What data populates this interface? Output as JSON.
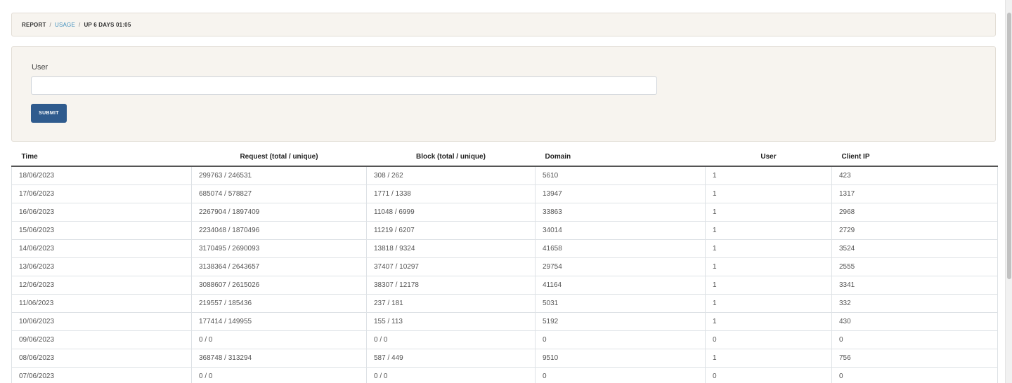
{
  "breadcrumb": {
    "report": "REPORT",
    "separator": "/",
    "usage": "USAGE",
    "uptime": "UP 6 DAYS 01:05"
  },
  "filter": {
    "user_label": "User",
    "user_value": "",
    "user_placeholder": "",
    "submit_label": "SUBMIT"
  },
  "table": {
    "headers": {
      "time": "Time",
      "request": "Request (total / unique)",
      "block": "Block (total / unique)",
      "domain": "Domain",
      "user": "User",
      "client_ip": "Client IP"
    },
    "rows": [
      {
        "time": "18/06/2023",
        "request": "299763 / 246531",
        "block": "308 / 262",
        "domain": "5610",
        "user": "1",
        "client_ip": "423"
      },
      {
        "time": "17/06/2023",
        "request": "685074 / 578827",
        "block": "1771 / 1338",
        "domain": "13947",
        "user": "1",
        "client_ip": "1317"
      },
      {
        "time": "16/06/2023",
        "request": "2267904 / 1897409",
        "block": "11048 / 6999",
        "domain": "33863",
        "user": "1",
        "client_ip": "2968"
      },
      {
        "time": "15/06/2023",
        "request": "2234048 / 1870496",
        "block": "11219 / 6207",
        "domain": "34014",
        "user": "1",
        "client_ip": "2729"
      },
      {
        "time": "14/06/2023",
        "request": "3170495 / 2690093",
        "block": "13818 / 9324",
        "domain": "41658",
        "user": "1",
        "client_ip": "3524"
      },
      {
        "time": "13/06/2023",
        "request": "3138364 / 2643657",
        "block": "37407 / 10297",
        "domain": "29754",
        "user": "1",
        "client_ip": "2555"
      },
      {
        "time": "12/06/2023",
        "request": "3088607 / 2615026",
        "block": "38307 / 12178",
        "domain": "41164",
        "user": "1",
        "client_ip": "3341"
      },
      {
        "time": "11/06/2023",
        "request": "219557 / 185436",
        "block": "237 / 181",
        "domain": "5031",
        "user": "1",
        "client_ip": "332"
      },
      {
        "time": "10/06/2023",
        "request": "177414 / 149955",
        "block": "155 / 113",
        "domain": "5192",
        "user": "1",
        "client_ip": "430"
      },
      {
        "time": "09/06/2023",
        "request": "0 / 0",
        "block": "0 / 0",
        "domain": "0",
        "user": "0",
        "client_ip": "0"
      },
      {
        "time": "08/06/2023",
        "request": "368748 / 313294",
        "block": "587 / 449",
        "domain": "9510",
        "user": "1",
        "client_ip": "756"
      },
      {
        "time": "07/06/2023",
        "request": "0 / 0",
        "block": "0 / 0",
        "domain": "0",
        "user": "0",
        "client_ip": "0"
      }
    ]
  },
  "colors": {
    "panel_background": "#f7f4ef",
    "link": "#3c8dbc",
    "submit_button": "#2f5b8e"
  }
}
